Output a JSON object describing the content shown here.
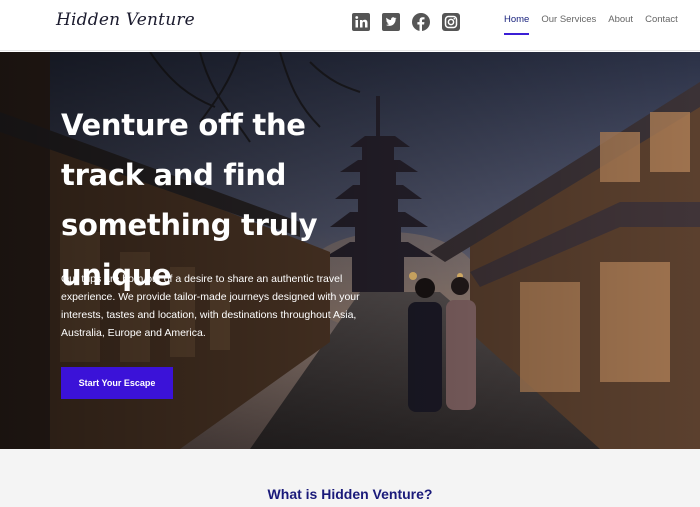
{
  "header": {
    "logo_text": "Hidden Venture",
    "socials": [
      {
        "icon": "linkedin-icon"
      },
      {
        "icon": "twitter-icon"
      },
      {
        "icon": "facebook-icon"
      },
      {
        "icon": "instagram-icon"
      }
    ],
    "nav": [
      {
        "label": "Home",
        "active": true
      },
      {
        "label": "Our Services",
        "active": false
      },
      {
        "label": "About",
        "active": false
      },
      {
        "label": "Contact",
        "active": false
      }
    ]
  },
  "hero": {
    "title": "Venture off the track and find something truly unique",
    "description": "Our trips are born out of a desire to share an authentic travel experience. We provide tailor-made journeys designed with your interests, tastes and location, with destinations throughout Asia, Australia, Europe and America.",
    "cta_label": "Start Your Escape"
  },
  "section": {
    "title": "What is Hidden Venture?"
  },
  "colors": {
    "accent": "#3b12d8",
    "nav_active": "#1a237e",
    "section_title": "#1a1a7a",
    "icon_gray": "#555555"
  }
}
